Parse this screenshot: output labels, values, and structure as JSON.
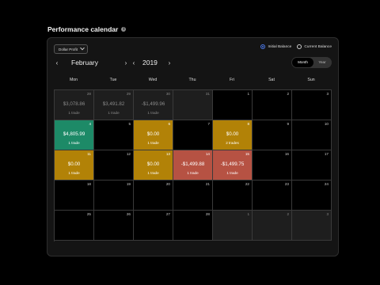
{
  "header": {
    "title": "Performance calendar"
  },
  "controls": {
    "dropdown_label": "Dollar Profit",
    "radio_initial": "Initial Balance",
    "radio_current": "Current Balance",
    "selected_radio": "Initial Balance",
    "month": "February",
    "year": "2019",
    "view_month": "Month",
    "view_year": "Year",
    "active_view": "Month"
  },
  "weekdays": [
    "Mon",
    "Tue",
    "Wed",
    "Thu",
    "Fri",
    "Sat",
    "Sun"
  ],
  "colors": {
    "profit": "#1d8a67",
    "breakeven": "#b28207",
    "loss": "#b65243",
    "selected": "#4b76e3"
  },
  "days": [
    {
      "day": "28",
      "value": "$3,078.86",
      "trades": "1 trade",
      "type": "out"
    },
    {
      "day": "29",
      "value": "$3,491.82",
      "trades": "1 trade",
      "type": "out"
    },
    {
      "day": "30",
      "value": "-$1,499.96",
      "trades": "1 trade",
      "type": "out"
    },
    {
      "day": "31",
      "value": "",
      "trades": "",
      "type": "out"
    },
    {
      "day": "1",
      "value": "",
      "trades": "",
      "type": "in"
    },
    {
      "day": "2",
      "value": "",
      "trades": "",
      "type": "in"
    },
    {
      "day": "3",
      "value": "",
      "trades": "",
      "type": "in"
    },
    {
      "day": "4",
      "value": "$4,805.99",
      "trades": "1 trade",
      "type": "green"
    },
    {
      "day": "5",
      "value": "",
      "trades": "",
      "type": "in"
    },
    {
      "day": "6",
      "value": "$0.00",
      "trades": "1 trade",
      "type": "gold"
    },
    {
      "day": "7",
      "value": "",
      "trades": "",
      "type": "in"
    },
    {
      "day": "8",
      "value": "$0.00",
      "trades": "2 trades",
      "type": "gold"
    },
    {
      "day": "9",
      "value": "",
      "trades": "",
      "type": "in"
    },
    {
      "day": "10",
      "value": "",
      "trades": "",
      "type": "in"
    },
    {
      "day": "11",
      "value": "$0.00",
      "trades": "1 trade",
      "type": "gold"
    },
    {
      "day": "12",
      "value": "",
      "trades": "",
      "type": "in"
    },
    {
      "day": "13",
      "value": "$0.00",
      "trades": "1 trade",
      "type": "gold"
    },
    {
      "day": "14",
      "value": "-$1,499.88",
      "trades": "1 trade",
      "type": "red"
    },
    {
      "day": "15",
      "value": "-$1,499.75",
      "trades": "1 trade",
      "type": "red"
    },
    {
      "day": "16",
      "value": "",
      "trades": "",
      "type": "in"
    },
    {
      "day": "17",
      "value": "",
      "trades": "",
      "type": "in"
    },
    {
      "day": "18",
      "value": "",
      "trades": "",
      "type": "in"
    },
    {
      "day": "19",
      "value": "",
      "trades": "",
      "type": "in"
    },
    {
      "day": "20",
      "value": "",
      "trades": "",
      "type": "in"
    },
    {
      "day": "21",
      "value": "",
      "trades": "",
      "type": "in"
    },
    {
      "day": "22",
      "value": "",
      "trades": "",
      "type": "in"
    },
    {
      "day": "23",
      "value": "",
      "trades": "",
      "type": "in"
    },
    {
      "day": "24",
      "value": "",
      "trades": "",
      "type": "in"
    },
    {
      "day": "25",
      "value": "",
      "trades": "",
      "type": "in"
    },
    {
      "day": "26",
      "value": "",
      "trades": "",
      "type": "in"
    },
    {
      "day": "27",
      "value": "",
      "trades": "",
      "type": "in"
    },
    {
      "day": "28",
      "value": "",
      "trades": "",
      "type": "in"
    },
    {
      "day": "1",
      "value": "",
      "trades": "",
      "type": "out"
    },
    {
      "day": "2",
      "value": "",
      "trades": "",
      "type": "out"
    },
    {
      "day": "3",
      "value": "",
      "trades": "",
      "type": "out"
    }
  ]
}
